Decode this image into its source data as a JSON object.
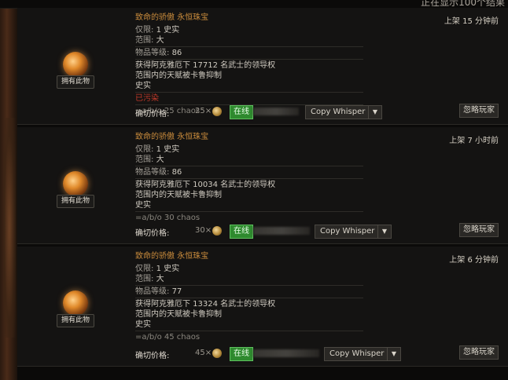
{
  "header": {
    "truncated_text": "正在显示100个结果"
  },
  "listings": [
    {
      "item_name": "致命的骄傲 永恒珠宝",
      "owned_label": "拥有此物",
      "limit_label": "仅限:",
      "limit_value": "1 史实",
      "range_label": "范围:",
      "range_value": "大",
      "level_label": "物品等级:",
      "level_value": "86",
      "mod_line1": "获得阿克雅厄下 17712 名武士的领导权",
      "mod_line2": "范围内的天赋被卡鲁抑制",
      "rarity": "史实",
      "status": "已污染",
      "price_note": "=a/b/o 25 chaos",
      "time": "上架 15 分钟前",
      "price_label": "确切价格:",
      "price_amount": "25×",
      "online_label": "在线",
      "whisper_label": "Copy Whisper",
      "dropdown_icon": "caret-down",
      "ignore_label": "忽略玩家"
    },
    {
      "item_name": "致命的骄傲 永恒珠宝",
      "owned_label": "拥有此物",
      "limit_label": "仅限:",
      "limit_value": "1 史实",
      "range_label": "范围:",
      "range_value": "大",
      "level_label": "物品等级:",
      "level_value": "86",
      "mod_line1": "获得阿克雅厄下 10034 名武士的领导权",
      "mod_line2": "范围内的天赋被卡鲁抑制",
      "rarity": "史实",
      "price_note": "=a/b/o 30 chaos",
      "time": "上架 7 小时前",
      "price_label": "确切价格:",
      "price_amount": "30×",
      "online_label": "在线",
      "whisper_label": "Copy Whisper",
      "dropdown_icon": "caret-down",
      "ignore_label": "忽略玩家"
    },
    {
      "item_name": "致命的骄傲 永恒珠宝",
      "owned_label": "拥有此物",
      "limit_label": "仅限:",
      "limit_value": "1 史实",
      "range_label": "范围:",
      "range_value": "大",
      "level_label": "物品等级:",
      "level_value": "77",
      "mod_line1": "获得阿克雅厄下 13324 名武士的领导权",
      "mod_line2": "范围内的天赋被卡鲁抑制",
      "rarity": "史实",
      "price_note": "=a/b/o 45 chaos",
      "time": "上架 6 分钟前",
      "price_label": "确切价格:",
      "price_amount": "45×",
      "online_label": "在线",
      "whisper_label": "Copy Whisper",
      "dropdown_icon": "caret-down",
      "ignore_label": "忽略玩家"
    }
  ],
  "colors": {
    "item_name": "#c98b3c",
    "online": "#2e8a2e",
    "corrupted": "#c23a2a"
  }
}
